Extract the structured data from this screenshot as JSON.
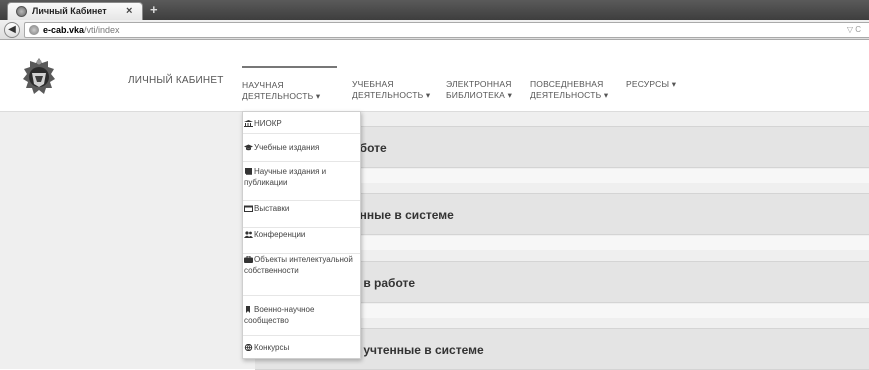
{
  "browser": {
    "tab_title": "Личный Кабинет",
    "tab_close": "×",
    "new_tab": "+",
    "back_icon": "arrow-left-icon",
    "url_host": "e-cab.vka",
    "url_path": "/vti/index",
    "url_dropdown": "▽ C"
  },
  "navbar": {
    "brand": "ЛИЧНЫЙ КАБИНЕТ",
    "items": [
      {
        "label_line1": "НАУЧНАЯ",
        "label_line2": "ДЕЯТЕЛЬНОСТЬ ▾",
        "active": true
      },
      {
        "label_line1": "УЧЕБНАЯ",
        "label_line2": "ДЕЯТЕЛЬНОСТЬ ▾"
      },
      {
        "label_line1": "ЭЛЕКТРОННАЯ",
        "label_line2": "БИБЛИОТЕКА ▾"
      },
      {
        "label_line1": "ПОВСЕДНЕВНАЯ",
        "label_line2": "ДЕЯТЕЛЬНОСТЬ ▾"
      },
      {
        "label_line1": "РЕСУРСЫ ▾",
        "label_line2": ""
      }
    ]
  },
  "dropdown": {
    "items": [
      {
        "label": "НИОКР",
        "icon": "university-icon"
      },
      {
        "label": "Учебные издания",
        "icon": "graduation-cap-icon"
      },
      {
        "label": "Научные издания и публикации",
        "icon": "book-icon"
      },
      {
        "label": "Выставки",
        "icon": "calendar-icon"
      },
      {
        "label": "Конференции",
        "icon": "users-icon"
      },
      {
        "label": "Объекты интелектуальной собственности",
        "icon": "briefcase-icon"
      },
      {
        "label": "Военно-научное сообщество",
        "icon": "bookmark-icon"
      },
      {
        "label": "Конкурсы",
        "icon": "globe-icon"
      }
    ]
  },
  "panels": [
    {
      "title": "аботе"
    },
    {
      "title": "енные в системе"
    },
    {
      "title": "я в работе"
    },
    {
      "title": "я учтенные в системе"
    }
  ],
  "colors": {
    "content_background": "#efefef",
    "panel_background": "#e4e4e4",
    "active_nav_border": "#777777"
  }
}
